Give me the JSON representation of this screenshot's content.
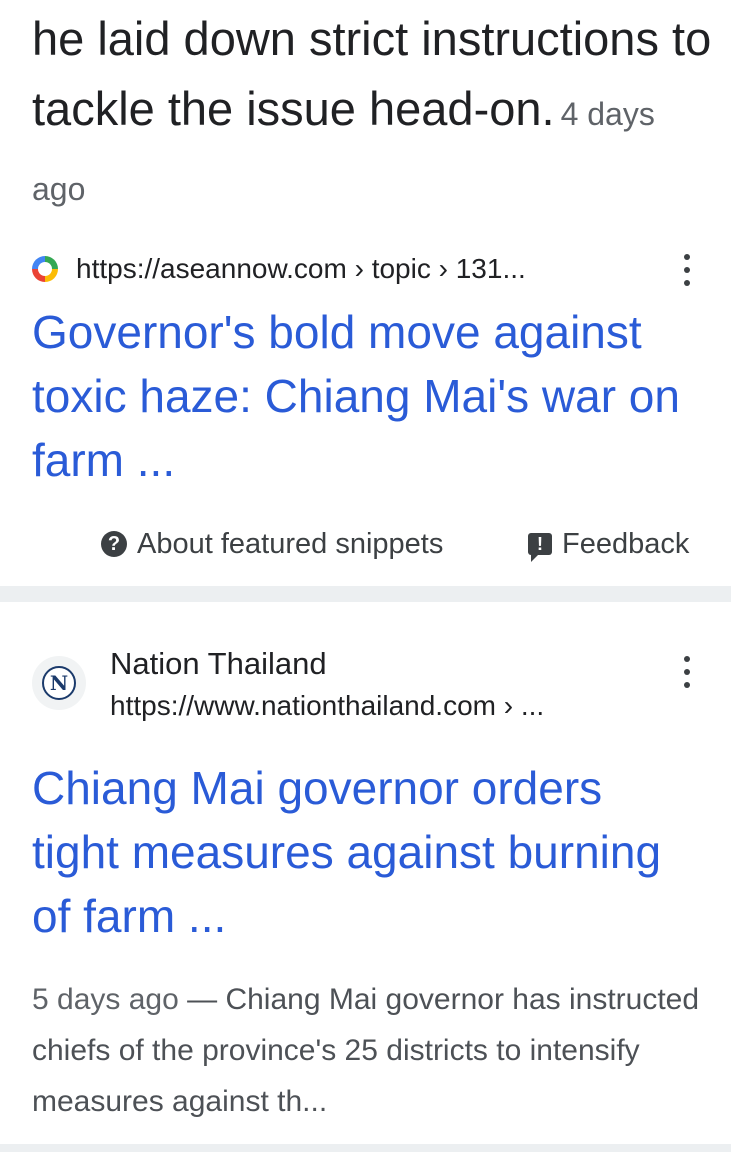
{
  "snippet": {
    "text": "he laid down strict instructions to tackle the issue head-on.",
    "date": "4 days ago"
  },
  "featured": {
    "url": "https://aseannow.com › topic › 131...",
    "title": "Governor's bold move against toxic haze: Chiang Mai's war on farm ...",
    "about_label": "About featured snippets",
    "feedback_label": "Feedback"
  },
  "result2": {
    "site_name": "Nation Thailand",
    "logo_letter": "N",
    "url": "https://www.nationthailand.com › ...",
    "title": "Chiang Mai governor orders tight measures against burning of farm ...",
    "date": "5 days ago",
    "separator": " — ",
    "description": "Chiang Mai governor has instructed chiefs of the province's 25 districts to intensify measures against th..."
  },
  "icons": {
    "favicon": "aseannow-favicon-icon",
    "menu": "more-vert-icon",
    "help": "question-circle-icon",
    "feedback": "feedback-icon"
  },
  "colors": {
    "link": "#2a5bd7",
    "text": "#202124",
    "muted": "#5f6368",
    "separator": "#eceff1"
  }
}
